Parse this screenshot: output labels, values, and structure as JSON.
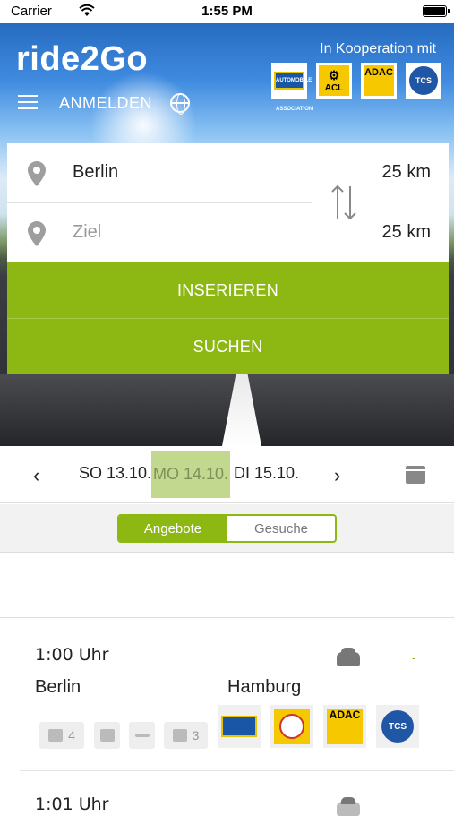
{
  "status": {
    "carrier": "Carrier",
    "time": "1:55 PM"
  },
  "header": {
    "logo": "ride2Go",
    "coop": "In Kooperation mit",
    "partners": [
      "AUTOMOBILE CLUB ASSOCIATION",
      "ACL",
      "ADAC",
      "TCS"
    ],
    "login": "ANMELDEN"
  },
  "search": {
    "from": "Berlin",
    "from_radius": "25 km",
    "to_placeholder": "Ziel",
    "to_radius": "25 km",
    "insert_label": "INSERIEREN",
    "search_label": "SUCHEN"
  },
  "dates": {
    "prev": "SO 13.10.",
    "current": "MO 14.10.",
    "next": "DI 15.10."
  },
  "tabs": {
    "offers": "Angebote",
    "requests": "Gesuche"
  },
  "rides": [
    {
      "time": "1:00 Uhr",
      "from": "Berlin",
      "to": "Hamburg",
      "likes": "4",
      "seats": "3",
      "price": "-"
    },
    {
      "time": "1:01 Uhr"
    }
  ],
  "colors": {
    "accent": "#8db814",
    "accent_light": "#c2d88f"
  }
}
